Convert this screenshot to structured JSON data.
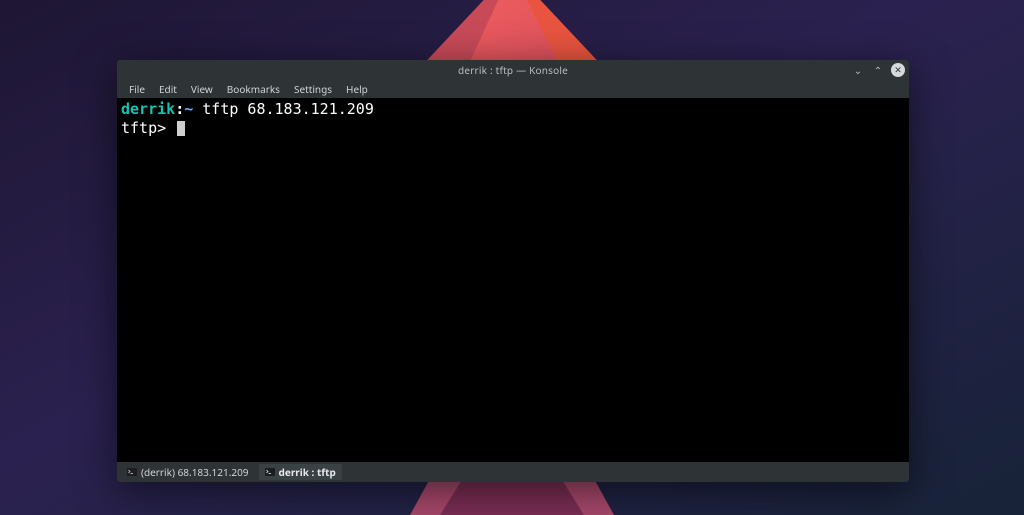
{
  "window": {
    "title": "derrik : tftp — Konsole"
  },
  "menubar": {
    "items": [
      "File",
      "Edit",
      "View",
      "Bookmarks",
      "Settings",
      "Help"
    ]
  },
  "terminal": {
    "prompt_user": "derrik",
    "prompt_sep": ":",
    "prompt_path": "~",
    "command": "tftp 68.183.121.209",
    "tftp_prompt": "tftp>"
  },
  "tabs": {
    "items": [
      {
        "label": "(derrik) 68.183.121.209",
        "active": false
      },
      {
        "label": "derrik : tftp",
        "active": true
      }
    ]
  },
  "titlebar_controls": {
    "minimize": "⌄",
    "maximize": "⌃",
    "close": "✕"
  }
}
